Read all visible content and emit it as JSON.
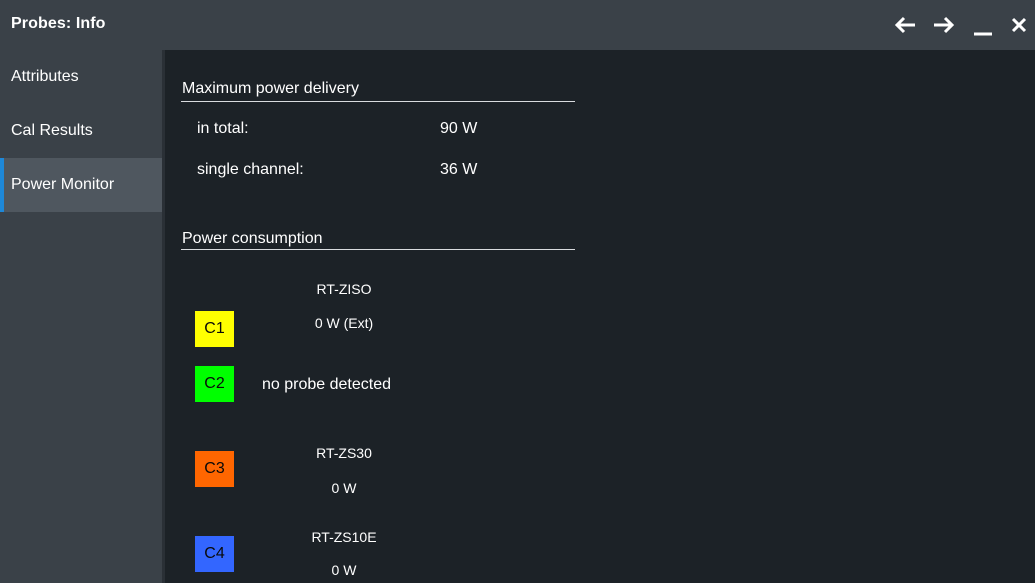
{
  "window": {
    "title": "Probes: Info",
    "controls": [
      "arrow-left-icon",
      "arrow-right-icon",
      "minimize-icon",
      "close-icon"
    ]
  },
  "sidebar": {
    "items": [
      {
        "label": "Attributes"
      },
      {
        "label": "Cal Results"
      },
      {
        "label": "Power Monitor",
        "active": true
      }
    ]
  },
  "max_power": {
    "title": "Maximum power delivery",
    "total_label": "in total:",
    "total_value": "90 W",
    "single_label": "single channel:",
    "single_value": "36 W"
  },
  "consumption": {
    "title": "Power consumption",
    "channels": [
      {
        "id": "C1",
        "color": "#ffff00",
        "probe": "RT-ZISO",
        "power": "0 W (Ext)"
      },
      {
        "id": "C2",
        "color": "#00ff00",
        "status": "no probe detected"
      },
      {
        "id": "C3",
        "color": "#ff6600",
        "probe": "RT-ZS30",
        "power": "0 W"
      },
      {
        "id": "C4",
        "color": "#3366ff",
        "probe": "RT-ZS10E",
        "power": "0 W"
      }
    ]
  },
  "colors": {
    "titlebar_bg": "#3a4148",
    "content_bg": "#1c2227",
    "active_accent": "#1e88d8"
  }
}
